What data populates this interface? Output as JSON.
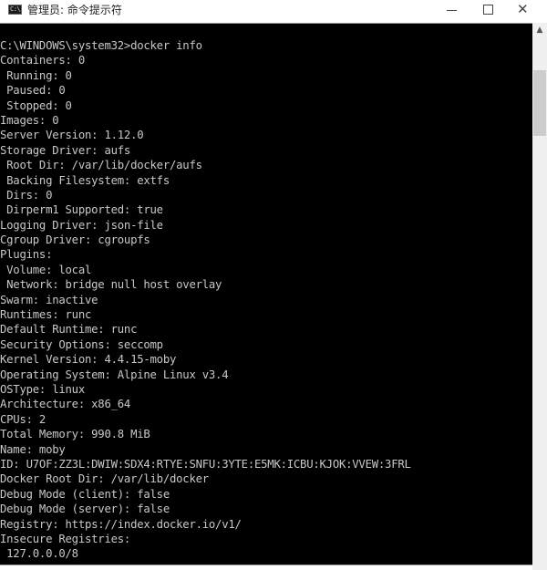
{
  "window": {
    "title": "管理员: 命令提示符",
    "icon": "cmd-icon",
    "icon_text": "C:\\."
  },
  "controls": {
    "minimize": "minimize-icon",
    "maximize": "maximize-icon",
    "close": "close-icon",
    "close_glyph": "✕"
  },
  "scrollbar": {
    "up_arrow": "▲"
  },
  "console": {
    "lines": [
      "C:\\WINDOWS\\system32>docker info",
      "Containers: 0",
      " Running: 0",
      " Paused: 0",
      " Stopped: 0",
      "Images: 0",
      "Server Version: 1.12.0",
      "Storage Driver: aufs",
      " Root Dir: /var/lib/docker/aufs",
      " Backing Filesystem: extfs",
      " Dirs: 0",
      " Dirperm1 Supported: true",
      "Logging Driver: json-file",
      "Cgroup Driver: cgroupfs",
      "Plugins:",
      " Volume: local",
      " Network: bridge null host overlay",
      "Swarm: inactive",
      "Runtimes: runc",
      "Default Runtime: runc",
      "Security Options: seccomp",
      "Kernel Version: 4.4.15-moby",
      "Operating System: Alpine Linux v3.4",
      "OSType: linux",
      "Architecture: x86_64",
      "CPUs: 2",
      "Total Memory: 990.8 MiB",
      "Name: moby",
      "ID: U7OF:ZZ3L:DWIW:SDX4:RTYE:SNFU:3YTE:E5MK:ICBU:KJOK:VVEW:3FRL",
      "Docker Root Dir: /var/lib/docker",
      "Debug Mode (client): false",
      "Debug Mode (server): false",
      "Registry: https://index.docker.io/v1/",
      "Insecure Registries:",
      " 127.0.0.0/8"
    ]
  }
}
